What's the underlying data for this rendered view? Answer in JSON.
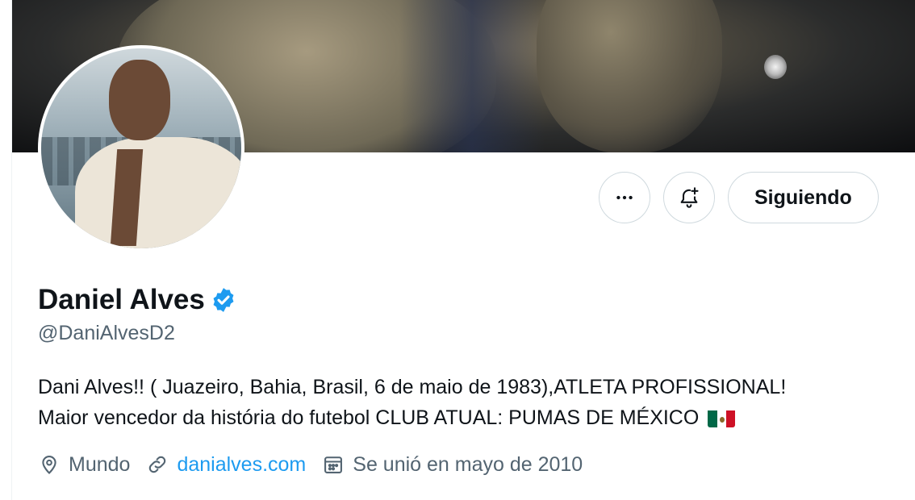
{
  "profile": {
    "display_name": "Daniel Alves",
    "handle": "@DaniAlvesD2",
    "verified": true,
    "bio_line1": "Dani Alves!! ( Juazeiro, Bahia, Brasil, 6 de maio de 1983),ATLETA PROFISSIONAL!",
    "bio_line2": "Maior vencedor da história do futebol CLUB ATUAL: PUMAS DE MÉXICO",
    "bio_emoji": "mexico-flag",
    "location": "Mundo",
    "website": "danialves.com",
    "joined": "Se unió en mayo de 2010"
  },
  "actions": {
    "more_icon": "more-horizontal-icon",
    "notify_icon": "notification-bell-plus-icon",
    "follow_label": "Siguiendo"
  },
  "colors": {
    "accent": "#1d9bf0",
    "text_primary": "#0f1419",
    "text_secondary": "#536471",
    "border": "#cfd9de"
  }
}
